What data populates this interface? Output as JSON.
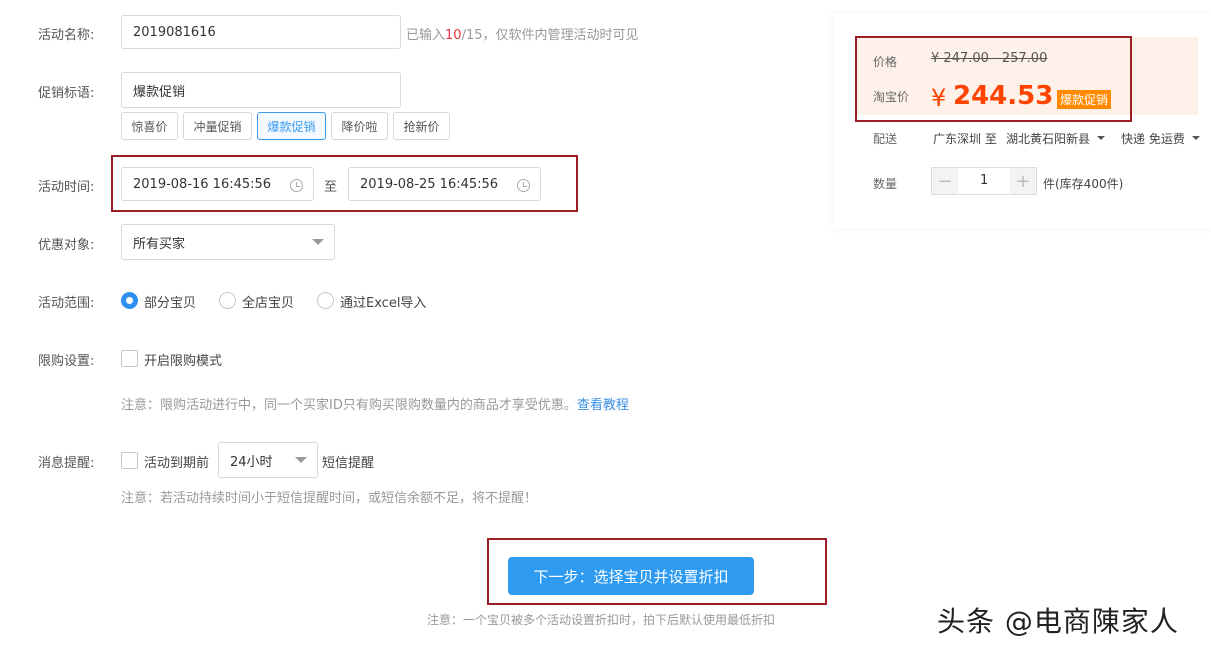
{
  "form": {
    "name_label": "活动名称:",
    "name_value": "2019081616",
    "name_hint_prefix": "已输入",
    "name_count": "10",
    "name_hint_suffix": "/15，仅软件内管理活动时可见",
    "slogan_label": "促销标语:",
    "slogan_value": "爆款促销",
    "slogan_tags": [
      "惊喜价",
      "冲量促销",
      "爆款促销",
      "降价啦",
      "抢新价"
    ],
    "time_label": "活动时间:",
    "start_time": "2019-08-16 16:45:56",
    "time_separator": "至",
    "end_time": "2019-08-25 16:45:56",
    "target_label": "优惠对象:",
    "target_value": "所有买家",
    "scope_label": "活动范围:",
    "scope_options": [
      "部分宝贝",
      "全店宝贝",
      "通过Excel导入"
    ],
    "scope_selected": "部分宝贝",
    "limit_label": "限购设置:",
    "limit_checkbox": "开启限购模式",
    "limit_note": "注意：限购活动进行中，同一个买家ID只有购买限购数量内的商品才享受优惠。",
    "limit_note_link": "查看教程",
    "remind_label": "消息提醒:",
    "remind_checkbox": "活动到期前",
    "remind_select": "24小时",
    "remind_suffix": "短信提醒",
    "remind_note": "注意：若活动持续时间小于短信提醒时间，或短信余额不足，将不提醒！",
    "next_button": "下一步：选择宝贝并设置折扣",
    "bottom_note": "注意：一个宝贝被多个活动设置折扣时，拍下后默认使用最低折扣"
  },
  "preview": {
    "price_label": "价格",
    "original_price": "¥ 247.00 - 257.00",
    "taobao_label": "淘宝价",
    "currency": "¥",
    "promo_price": "244.53",
    "promo_badge": "爆款促销",
    "ship_label": "配送",
    "ship_from": "广东深圳 至",
    "ship_to": "湖北黄石阳新县",
    "ship_method": "快递 免运费",
    "qty_label": "数量",
    "qty_minus": "−",
    "qty_value": "1",
    "qty_plus": "+",
    "stock": "件(库存400件)"
  },
  "watermark": "头条 @电商陳家人",
  "colors": {
    "accent": "#2f9bf0",
    "highlight_border": "#9b1c24",
    "promo_price": "#ff4400",
    "badge": "#ff8a00"
  }
}
